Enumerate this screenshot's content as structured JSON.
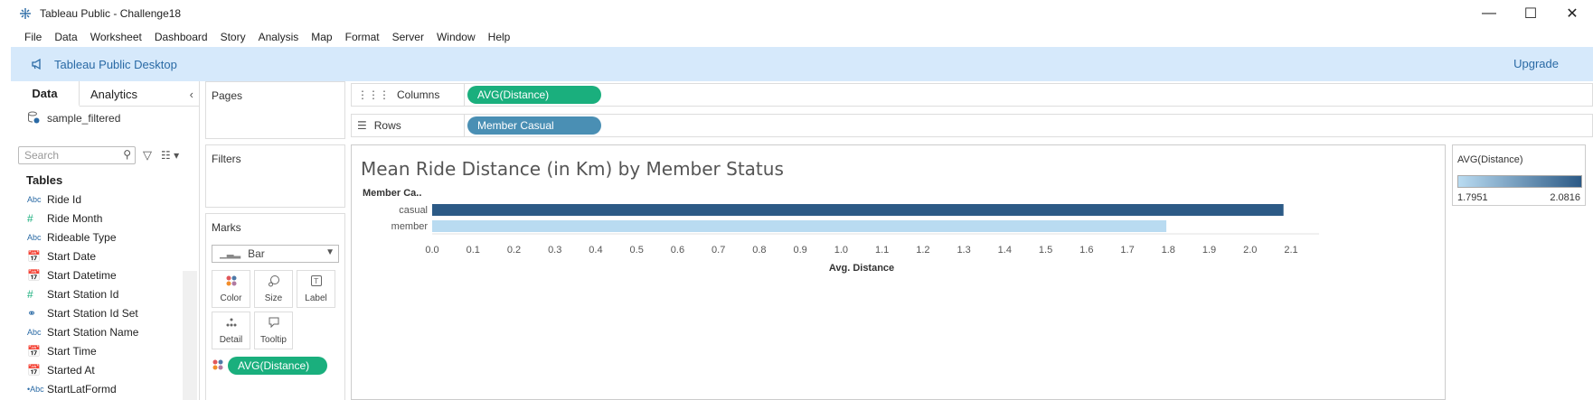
{
  "window": {
    "title": "Tableau Public - Challenge18",
    "minimize": "—",
    "maximize": "☐",
    "close": "✕"
  },
  "menu": [
    "File",
    "Data",
    "Worksheet",
    "Dashboard",
    "Story",
    "Analysis",
    "Map",
    "Format",
    "Server",
    "Window",
    "Help"
  ],
  "banner": {
    "title": "Tableau Public Desktop",
    "upgrade": "Upgrade"
  },
  "data_pane": {
    "tabs": [
      "Data",
      "Analytics"
    ],
    "datasource": "sample_filtered",
    "search_placeholder": "Search",
    "tables_heading": "Tables",
    "fields": [
      {
        "type": "Abc",
        "name": "Ride Id"
      },
      {
        "type": "#",
        "name": "Ride Month"
      },
      {
        "type": "Abc",
        "name": "Rideable Type"
      },
      {
        "type": "date",
        "name": "Start Date"
      },
      {
        "type": "datetime",
        "name": "Start Datetime"
      },
      {
        "type": "#",
        "name": "Start Station Id"
      },
      {
        "type": "set",
        "name": "Start Station Id Set"
      },
      {
        "type": "Abc",
        "name": "Start Station Name"
      },
      {
        "type": "datetime",
        "name": "Start Time"
      },
      {
        "type": "datetime",
        "name": "Started At"
      },
      {
        "type": "geoAbc",
        "name": "StartLatFormd"
      }
    ]
  },
  "cards": {
    "pages": "Pages",
    "filters": "Filters",
    "marks": "Marks",
    "mark_type": "Bar",
    "mark_buttons": [
      {
        "icon": "color-icon",
        "label": "Color"
      },
      {
        "icon": "size-icon",
        "label": "Size"
      },
      {
        "icon": "label-icon",
        "label": "Label"
      },
      {
        "icon": "detail-icon",
        "label": "Detail"
      },
      {
        "icon": "tooltip-icon",
        "label": "Tooltip"
      }
    ],
    "color_pill": "AVG(Distance)"
  },
  "shelves": {
    "columns_label": "Columns",
    "columns_pill": "AVG(Distance)",
    "rows_label": "Rows",
    "rows_pill": "Member Casual"
  },
  "colors": {
    "measure_pill": "#1aaf7d",
    "dimension_pill": "#4a8fb4",
    "banner": "#d6e9fb",
    "casual_bar": "#2c5a86",
    "member_bar": "#b9dbf1"
  },
  "legend": {
    "title": "AVG(Distance)",
    "min": "1.7951",
    "max": "2.0816"
  },
  "chart_data": {
    "type": "bar",
    "orientation": "horizontal",
    "title": "Mean Ride Distance (in Km) by Member Status",
    "row_header": "Member Ca..",
    "categories": [
      "casual",
      "member"
    ],
    "values": [
      2.0816,
      1.7951
    ],
    "xlabel": "Avg. Distance",
    "xlim": [
      0,
      2.1
    ],
    "xticks": [
      "0.0",
      "0.1",
      "0.2",
      "0.3",
      "0.4",
      "0.5",
      "0.6",
      "0.7",
      "0.8",
      "0.9",
      "1.0",
      "1.1",
      "1.2",
      "1.3",
      "1.4",
      "1.5",
      "1.6",
      "1.7",
      "1.8",
      "1.9",
      "2.0",
      "2.1"
    ]
  }
}
